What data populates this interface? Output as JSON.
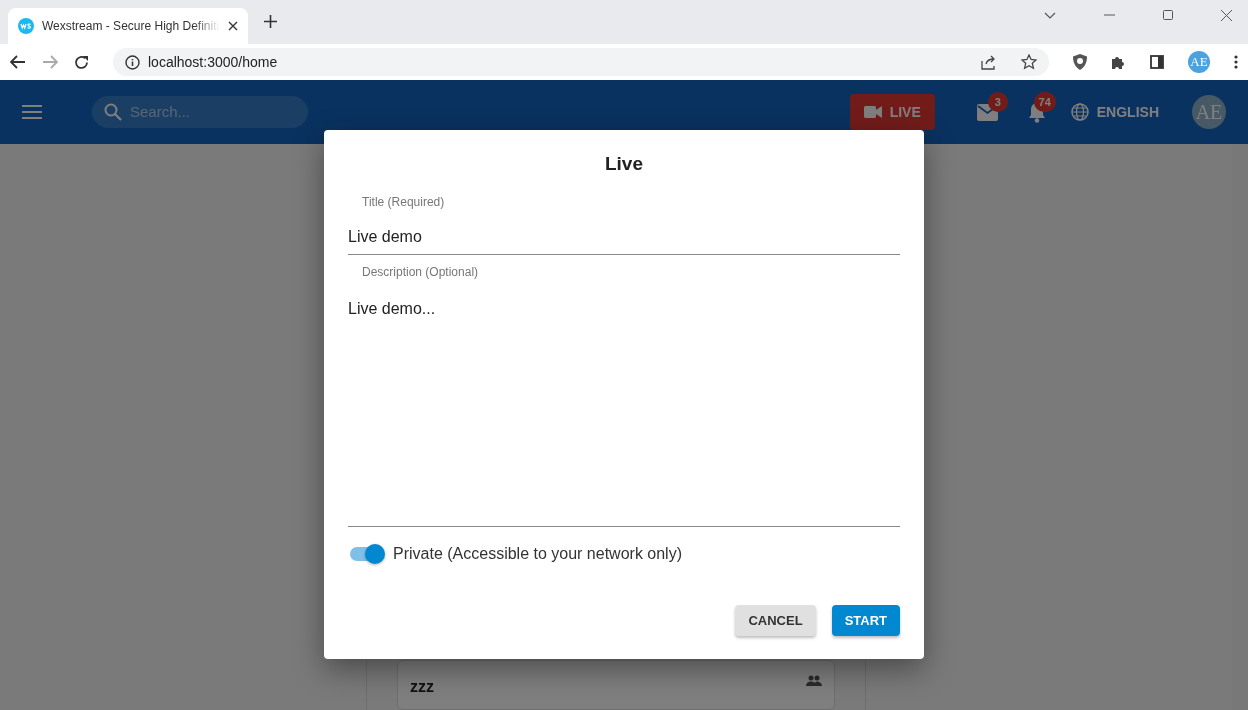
{
  "browser": {
    "tab_title": "Wexstream - Secure High Definiti",
    "address": "localhost:3000/home",
    "profile_avatar": "AE"
  },
  "header": {
    "search_placeholder": "Search...",
    "live_button": "LIVE",
    "messages_count": "3",
    "notifications_count": "74",
    "language": "ENGLISH",
    "avatar": "AE"
  },
  "feed": {
    "cards": [
      {
        "title": "zzz"
      }
    ]
  },
  "dialog": {
    "title": "Live",
    "fields": [
      {
        "kind": "input",
        "label": "Title (Required)",
        "value": "Live demo"
      },
      {
        "kind": "textarea",
        "label": "Description (Optional)",
        "value": "Live demo..."
      }
    ],
    "private_switch": {
      "label": "Private (Accessible to your network only)",
      "on": true
    },
    "buttons": [
      {
        "kind": "secondary",
        "label": "CANCEL"
      },
      {
        "kind": "primary",
        "label": "START"
      }
    ]
  }
}
